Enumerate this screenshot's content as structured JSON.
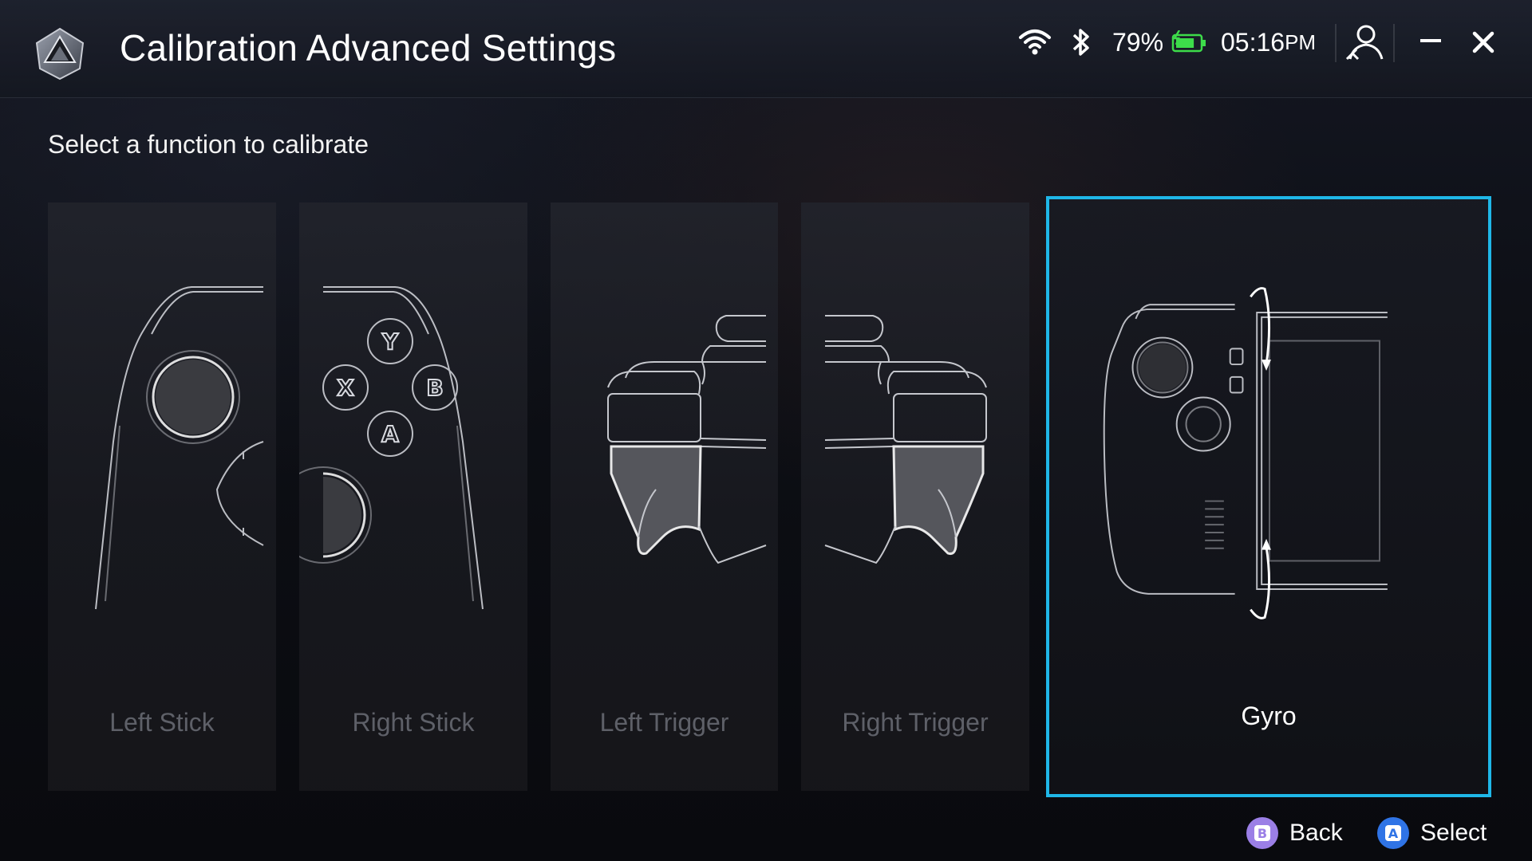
{
  "window": {
    "title": "Calibration Advanced Settings"
  },
  "status_bar": {
    "wifi_icon": "wifi-icon",
    "bluetooth_icon": "bluetooth-icon",
    "battery_percent": "79%",
    "battery_level": 0.79,
    "battery_charging": true,
    "time": "05:16",
    "ampm": "PM"
  },
  "window_controls": {
    "user_icon": "user-icon",
    "minimize_icon": "minimize-icon",
    "close_icon": "close-icon"
  },
  "main": {
    "instruction": "Select a function to calibrate",
    "functions": [
      {
        "label": "Left Stick",
        "icon": "left-stick-illustration",
        "selected": false
      },
      {
        "label": "Right Stick",
        "icon": "right-stick-illustration",
        "selected": false
      },
      {
        "label": "Left Trigger",
        "icon": "left-trigger-illustration",
        "selected": false
      },
      {
        "label": "Right Trigger",
        "icon": "right-trigger-illustration",
        "selected": false
      },
      {
        "label": "Gyro",
        "icon": "gyro-illustration",
        "selected": true
      }
    ]
  },
  "footer": {
    "back_label": "Back",
    "back_button_glyph": "B",
    "select_label": "Select",
    "select_button_glyph": "A"
  },
  "colors": {
    "accent": "#1fb7e8",
    "back_glyph_bg": "#9b7fe6",
    "select_glyph_bg": "#2f74e6",
    "battery_green": "#3ddc4a"
  }
}
